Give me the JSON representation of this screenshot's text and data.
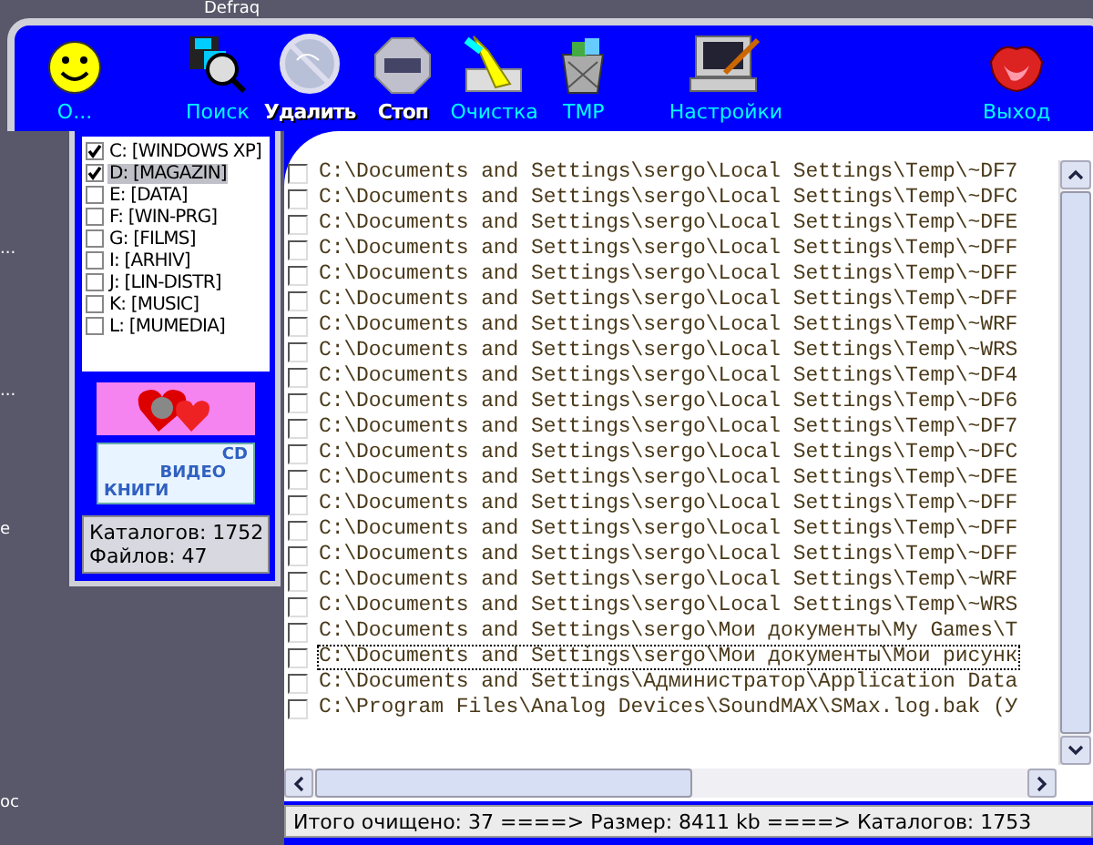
{
  "desktop": {
    "fragments": [
      "Defraq",
      "...",
      "...",
      "e",
      "oc"
    ]
  },
  "toolbar": {
    "items": [
      {
        "label": "О...",
        "disabled": false
      },
      {
        "label": "Поиск",
        "disabled": false
      },
      {
        "label": "Удалить",
        "disabled": true
      },
      {
        "label": "Стоп",
        "disabled": true
      },
      {
        "label": "Очистка",
        "disabled": false
      },
      {
        "label": "TMP",
        "disabled": false
      },
      {
        "label": "Настройки",
        "disabled": false
      },
      {
        "label": "Выход",
        "disabled": false
      }
    ]
  },
  "drives": [
    {
      "label": "C: [WINDOWS XP]",
      "checked": true,
      "selected": false
    },
    {
      "label": "D: [MAGAZIN]",
      "checked": true,
      "selected": true
    },
    {
      "label": "E: [DATA]",
      "checked": false,
      "selected": false
    },
    {
      "label": "F: [WIN-PRG]",
      "checked": false,
      "selected": false
    },
    {
      "label": "G: [FILMS]",
      "checked": false,
      "selected": false
    },
    {
      "label": "I: [ARHIV]",
      "checked": false,
      "selected": false
    },
    {
      "label": "J: [LIN-DISTR]",
      "checked": false,
      "selected": false
    },
    {
      "label": "K: [MUSIC]",
      "checked": false,
      "selected": false
    },
    {
      "label": "L: [MUMEDIA]",
      "checked": false,
      "selected": false
    }
  ],
  "banner": {
    "words": [
      "CD",
      "ВИДЕО",
      "КНИГИ"
    ]
  },
  "stats": [
    "Каталогов: 1752",
    "Файлов: 47"
  ],
  "files": [
    {
      "path": "C:\\Documents and Settings\\sergo\\Local Settings\\Temp\\~DF7",
      "checked": false,
      "focused": false
    },
    {
      "path": "C:\\Documents and Settings\\sergo\\Local Settings\\Temp\\~DFC",
      "checked": false,
      "focused": false
    },
    {
      "path": "C:\\Documents and Settings\\sergo\\Local Settings\\Temp\\~DFE",
      "checked": false,
      "focused": false
    },
    {
      "path": "C:\\Documents and Settings\\sergo\\Local Settings\\Temp\\~DFF",
      "checked": false,
      "focused": false
    },
    {
      "path": "C:\\Documents and Settings\\sergo\\Local Settings\\Temp\\~DFF",
      "checked": false,
      "focused": false
    },
    {
      "path": "C:\\Documents and Settings\\sergo\\Local Settings\\Temp\\~DFF",
      "checked": false,
      "focused": false
    },
    {
      "path": "C:\\Documents and Settings\\sergo\\Local Settings\\Temp\\~WRF",
      "checked": false,
      "focused": false
    },
    {
      "path": "C:\\Documents and Settings\\sergo\\Local Settings\\Temp\\~WRS",
      "checked": false,
      "focused": false
    },
    {
      "path": "C:\\Documents and Settings\\sergo\\Local Settings\\Temp\\~DF4",
      "checked": false,
      "focused": false
    },
    {
      "path": "C:\\Documents and Settings\\sergo\\Local Settings\\Temp\\~DF6",
      "checked": false,
      "focused": false
    },
    {
      "path": "C:\\Documents and Settings\\sergo\\Local Settings\\Temp\\~DF7",
      "checked": false,
      "focused": false
    },
    {
      "path": "C:\\Documents and Settings\\sergo\\Local Settings\\Temp\\~DFC",
      "checked": false,
      "focused": false
    },
    {
      "path": "C:\\Documents and Settings\\sergo\\Local Settings\\Temp\\~DFE",
      "checked": false,
      "focused": false
    },
    {
      "path": "C:\\Documents and Settings\\sergo\\Local Settings\\Temp\\~DFF",
      "checked": false,
      "focused": false
    },
    {
      "path": "C:\\Documents and Settings\\sergo\\Local Settings\\Temp\\~DFF",
      "checked": false,
      "focused": false
    },
    {
      "path": "C:\\Documents and Settings\\sergo\\Local Settings\\Temp\\~DFF",
      "checked": false,
      "focused": false
    },
    {
      "path": "C:\\Documents and Settings\\sergo\\Local Settings\\Temp\\~WRF",
      "checked": false,
      "focused": false
    },
    {
      "path": "C:\\Documents and Settings\\sergo\\Local Settings\\Temp\\~WRS",
      "checked": false,
      "focused": false
    },
    {
      "path": "C:\\Documents and Settings\\sergo\\Мои документы\\My Games\\T",
      "checked": false,
      "focused": false
    },
    {
      "path": "C:\\Documents and Settings\\sergo\\Мои документы\\Мои рисунк",
      "checked": false,
      "focused": true
    },
    {
      "path": "C:\\Documents and Settings\\Администратор\\Application Data",
      "checked": false,
      "focused": false
    },
    {
      "path": "C:\\Program Files\\Analog Devices\\SoundMAX\\SMax.log.bak (У",
      "checked": false,
      "focused": false
    }
  ],
  "status_bar": "Итого очищено: 37 ====> Размер: 8411 kb ====> Каталогов: 1753"
}
